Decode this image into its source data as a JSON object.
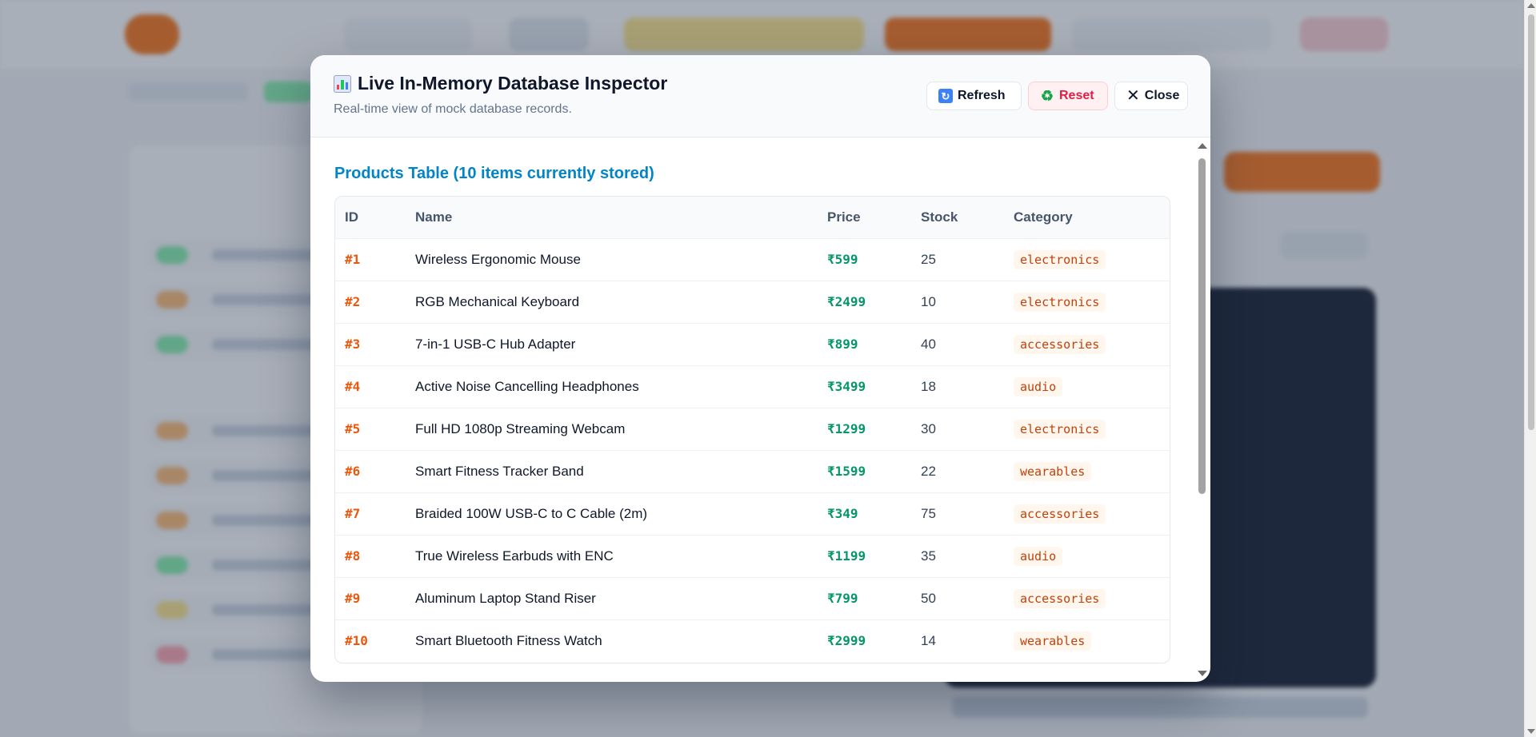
{
  "modal": {
    "title": "Live In-Memory Database Inspector",
    "title_icon": "bar-chart-icon",
    "subtitle": "Real-time view of mock database records.",
    "buttons": {
      "refresh_label": "Refresh",
      "refresh_icon": "refresh-icon",
      "reset_label": "Reset",
      "reset_icon": "recycle-icon",
      "close_label": "Close",
      "close_icon": "close-icon"
    }
  },
  "products": {
    "section_title": "Products Table (10 items currently stored)",
    "columns": [
      "ID",
      "Name",
      "Price",
      "Stock",
      "Category"
    ],
    "rows": [
      {
        "id": "#1",
        "name": "Wireless Ergonomic Mouse",
        "price": "₹599",
        "stock": "25",
        "category": "electronics"
      },
      {
        "id": "#2",
        "name": "RGB Mechanical Keyboard",
        "price": "₹2499",
        "stock": "10",
        "category": "electronics"
      },
      {
        "id": "#3",
        "name": "7-in-1 USB-C Hub Adapter",
        "price": "₹899",
        "stock": "40",
        "category": "accessories"
      },
      {
        "id": "#4",
        "name": "Active Noise Cancelling Headphones",
        "price": "₹3499",
        "stock": "18",
        "category": "audio"
      },
      {
        "id": "#5",
        "name": "Full HD 1080p Streaming Webcam",
        "price": "₹1299",
        "stock": "30",
        "category": "electronics"
      },
      {
        "id": "#6",
        "name": "Smart Fitness Tracker Band",
        "price": "₹1599",
        "stock": "22",
        "category": "wearables"
      },
      {
        "id": "#7",
        "name": "Braided 100W USB-C to C Cable (2m)",
        "price": "₹349",
        "stock": "75",
        "category": "accessories"
      },
      {
        "id": "#8",
        "name": "True Wireless Earbuds with ENC",
        "price": "₹1199",
        "stock": "35",
        "category": "audio"
      },
      {
        "id": "#9",
        "name": "Aluminum Laptop Stand Riser",
        "price": "₹799",
        "stock": "50",
        "category": "accessories"
      },
      {
        "id": "#10",
        "name": "Smart Bluetooth Fitness Watch",
        "price": "₹2999",
        "stock": "14",
        "category": "wearables"
      }
    ]
  },
  "colors": {
    "accent": "#0284c7",
    "id_color": "#ea580c",
    "price_color": "#059669",
    "reset_color": "#e11d48"
  }
}
